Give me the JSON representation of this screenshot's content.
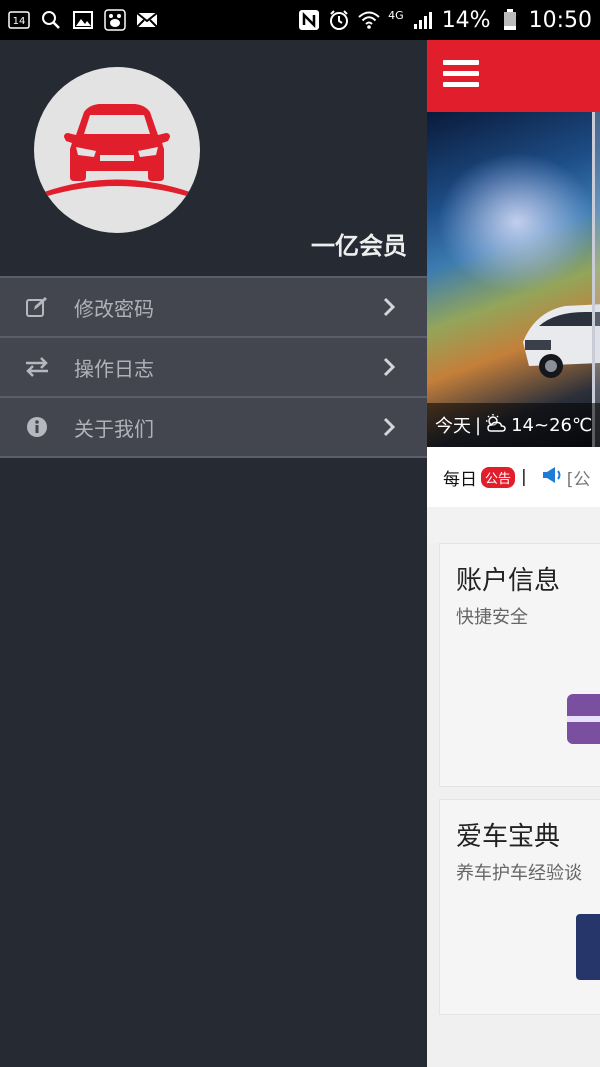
{
  "status_bar": {
    "notification_count": "14",
    "network": "4G",
    "battery": "14%",
    "time": "10:50"
  },
  "drawer": {
    "member_name": "一亿会员",
    "menu": [
      {
        "label": "修改密码",
        "icon": "edit-icon"
      },
      {
        "label": "操作日志",
        "icon": "swap-arrows-icon"
      },
      {
        "label": "关于我们",
        "icon": "info-icon"
      }
    ]
  },
  "main": {
    "weather": {
      "day": "今天",
      "temp": "14~26℃"
    },
    "notice": {
      "prefix": "每日",
      "badge": "公告",
      "separator": "|",
      "partial": "[公"
    },
    "cards": [
      {
        "title": "账户信息",
        "subtitle": "快捷安全"
      },
      {
        "title": "爱车宝典",
        "subtitle": "养车护车经验谈"
      }
    ]
  },
  "colors": {
    "accent_red": "#e11f2c",
    "drawer_bg": "#262a33",
    "menu_bg": "#43464f"
  }
}
